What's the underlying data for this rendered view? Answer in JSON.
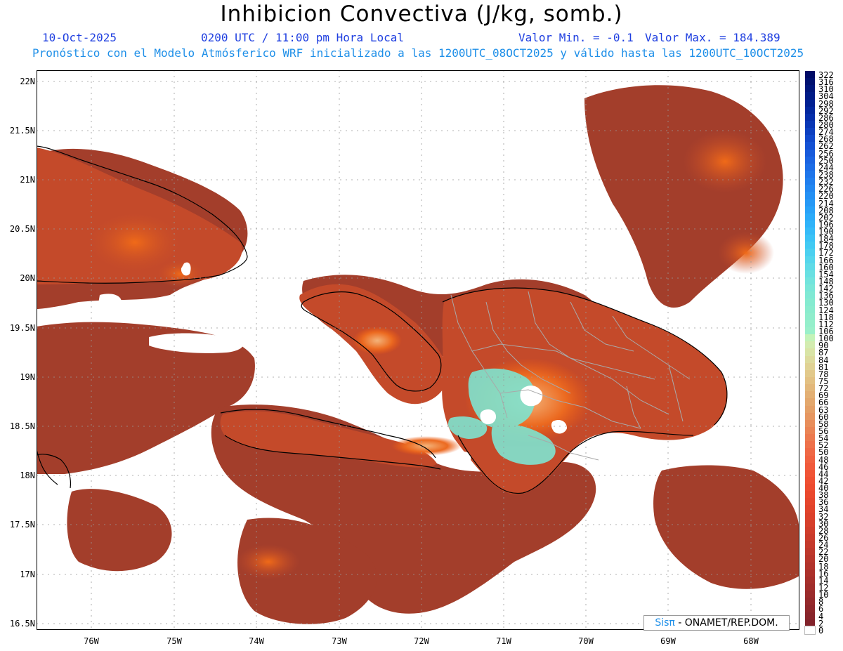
{
  "header": {
    "title": "Inhibicion Convectiva (J/kg, somb.)",
    "date": "10-Oct-2025",
    "time": "0200 UTC / 11:00 pm Hora Local",
    "value_min": "Valor Min. = -0.1",
    "value_max": "Valor Max. = 184.389",
    "subtitle": "Pronóstico con el Modelo Atmósferico WRF inicializado a las 1200UTC_08OCT2025 y válido hasta las  1200UTC_10OCT2025"
  },
  "map": {
    "lat_labels": [
      "22N",
      "21.5N",
      "21N",
      "20.5N",
      "20N",
      "19.5N",
      "19N",
      "18.5N",
      "18N",
      "17.5N",
      "17N",
      "16.5N"
    ],
    "lon_labels": [
      "76W",
      "75W",
      "74W",
      "73W",
      "72W",
      "71W",
      "70W",
      "69W",
      "68W"
    ],
    "field_colors": {
      "ocean": "#a33e2b",
      "land": "#c44a2a",
      "hot": "#ec5a12",
      "mid": "#e9a06a",
      "high": "#7fe4d0",
      "coast": "#000000",
      "borders": "#a9a9a9"
    }
  },
  "colorbar": {
    "labels": [
      "322",
      "316",
      "310",
      "304",
      "298",
      "292",
      "286",
      "280",
      "274",
      "268",
      "262",
      "256",
      "250",
      "244",
      "238",
      "232",
      "226",
      "220",
      "214",
      "208",
      "202",
      "196",
      "190",
      "184",
      "178",
      "172",
      "166",
      "160",
      "154",
      "148",
      "142",
      "136",
      "130",
      "124",
      "118",
      "112",
      "106",
      "100",
      "90",
      "87",
      "84",
      "81",
      "78",
      "75",
      "72",
      "69",
      "66",
      "63",
      "60",
      "58",
      "56",
      "54",
      "52",
      "50",
      "48",
      "46",
      "44",
      "42",
      "40",
      "38",
      "36",
      "34",
      "32",
      "30",
      "28",
      "26",
      "24",
      "22",
      "20",
      "18",
      "16",
      "14",
      "12",
      "10",
      "8",
      "6",
      "4",
      "2",
      "0"
    ],
    "colors": [
      "#000b66",
      "#001170",
      "#00167b",
      "#001b86",
      "#002092",
      "#02279e",
      "#052eaa",
      "#0836b5",
      "#0c3fc0",
      "#1048cb",
      "#1451d4",
      "#175adb",
      "#1a63e1",
      "#1c6ce6",
      "#1e75ea",
      "#207eee",
      "#2287f1",
      "#2490f4",
      "#2699f6",
      "#28a2f8",
      "#2babf9",
      "#2fb3f9",
      "#35bbf8",
      "#3bc3f6",
      "#42caf3",
      "#4bd0f0",
      "#55d6ec",
      "#5fdbe7",
      "#69e0e2",
      "#72e4dd",
      "#7ae7d8",
      "#80e9d4",
      "#85ebd0",
      "#8aecce",
      "#8fedcc",
      "#95efcb",
      "#9bf0ca",
      "#c4f3b8",
      "#d3ecb0",
      "#d9e4a6",
      "#dddb9d",
      "#e0d294",
      "#e2c98b",
      "#e3c183",
      "#e3b87b",
      "#e3b074",
      "#e3a86d",
      "#e4a067",
      "#e69761",
      "#e88e5b",
      "#ea8455",
      "#ec7a4f",
      "#ee714a",
      "#ef6845",
      "#f06140",
      "#f05a3b",
      "#f05436",
      "#ef4f32",
      "#ed4b2f",
      "#ea482d",
      "#e6452c",
      "#e1432b",
      "#dc412b",
      "#d63f2b",
      "#d03d2b",
      "#ca3b2b",
      "#c4392b",
      "#be372b",
      "#b8352b",
      "#b2332b",
      "#ac312b",
      "#a62f2b",
      "#a02d2b",
      "#9a2b2b",
      "#94292b",
      "#8e272b",
      "#88252b",
      "#82232b",
      "#ffffff"
    ]
  },
  "credit": {
    "part1": "Sisπ",
    "part2": " - ONAMET/REP.DOM."
  }
}
